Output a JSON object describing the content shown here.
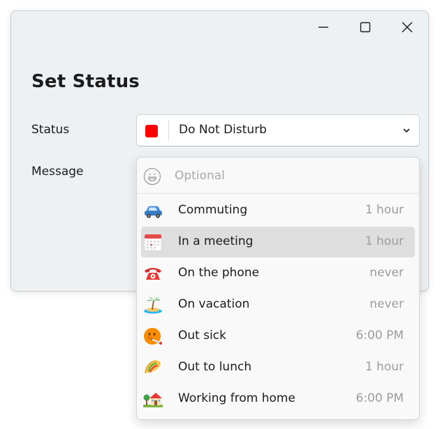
{
  "window": {
    "title": "Set Status",
    "caption_buttons": [
      "minimize-icon",
      "maximize-icon",
      "close-icon"
    ]
  },
  "status": {
    "label": "Status",
    "value": "Do Not Disturb",
    "color": "#ff0000"
  },
  "message": {
    "label": "Message",
    "placeholder": "Optional",
    "options": [
      {
        "icon": "car-icon",
        "label": "Commuting",
        "duration": "1 hour"
      },
      {
        "icon": "calendar-icon",
        "label": "In a meeting",
        "duration": "1 hour",
        "selected": true
      },
      {
        "icon": "telephone-icon",
        "label": "On the phone",
        "duration": "never"
      },
      {
        "icon": "island-icon",
        "label": "On vacation",
        "duration": "never"
      },
      {
        "icon": "thermometer-face-icon",
        "label": "Out sick",
        "duration": "6:00 PM"
      },
      {
        "icon": "taco-icon",
        "label": "Out to lunch",
        "duration": "1 hour"
      },
      {
        "icon": "house-icon",
        "label": "Working from home",
        "duration": "6:00 PM"
      }
    ]
  },
  "colors": {
    "window_bg": "#eef1f3",
    "selected_row_bg": "#dedede",
    "duration_text": "#9a9c9e"
  }
}
